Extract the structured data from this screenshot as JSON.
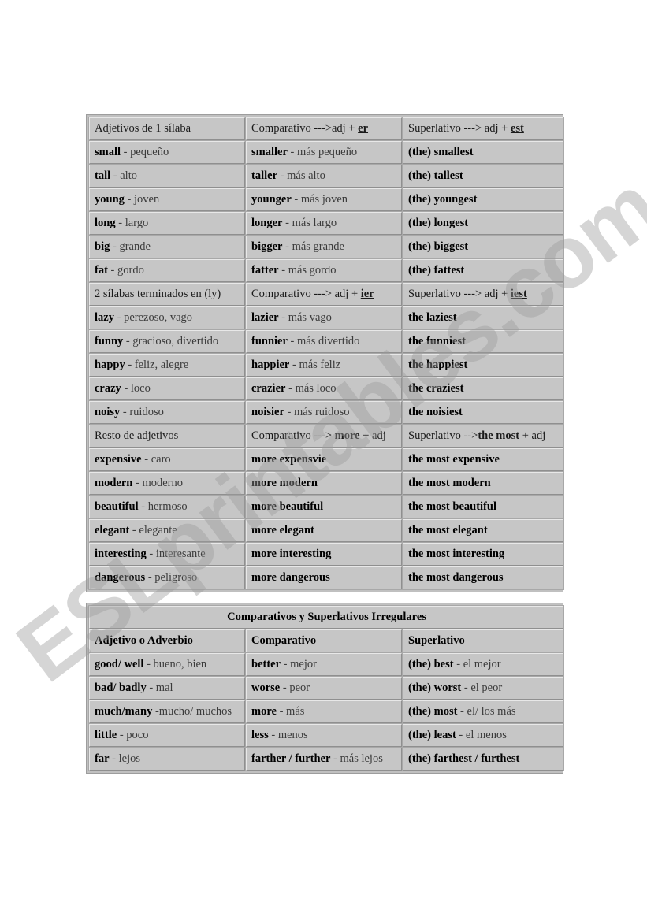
{
  "colors": {
    "highlight_yellow": "#ffff8a",
    "cell_gray": "#c6c6c6",
    "page_white": "#ffffff",
    "watermark_gray": "#9a9a9a"
  },
  "watermark": {
    "text": "ESLprintables.com"
  },
  "table_one": {
    "groups": [
      {
        "header": {
          "col1": "Adjetivos de 1 sílaba",
          "col2_pre": "Comparativo --->adj + ",
          "col2_kw": "er",
          "col2_post": "",
          "col3_pre": "Superlativo ---> adj + ",
          "col3_kw": "est",
          "col3_post": ""
        },
        "rows": [
          {
            "en": "small",
            "sep": " - ",
            "es": "pequeño",
            "comp_en": "smaller",
            "comp_sep": " - ",
            "comp_es": "más pequeño",
            "sup": "(the) smallest"
          },
          {
            "en": "tall",
            "sep": " - ",
            "es": "alto",
            "comp_en": "taller",
            "comp_sep": " - ",
            "comp_es": "más alto",
            "sup": "(the) tallest"
          },
          {
            "en": "young",
            "sep": " - ",
            "es": "joven",
            "comp_en": "younger",
            "comp_sep": " - ",
            "comp_es": "más joven",
            "sup": "(the) youngest"
          },
          {
            "en": "long",
            "sep": " - ",
            "es": "largo",
            "comp_en": "longer",
            "comp_sep": " - ",
            "comp_es": "más largo",
            "sup": "(the) longest"
          },
          {
            "en": "big",
            "sep": " - ",
            "es": "grande",
            "comp_en": "bigger",
            "comp_sep": " - ",
            "comp_es": "más grande",
            "sup": "(the) biggest"
          },
          {
            "en": "fat",
            "sep": " - ",
            "es": "gordo",
            "comp_en": "fatter",
            "comp_sep": " - ",
            "comp_es": "más gordo",
            "sup": "(the) fattest"
          }
        ]
      },
      {
        "header": {
          "col1": "2 sílabas terminados en (ly)",
          "col2_pre": "Comparativo ---> adj + ",
          "col2_kw": "ier",
          "col2_post": "",
          "col3_pre": "Superlativo ---> adj + ",
          "col3_kw": "iest",
          "col3_post": ""
        },
        "rows": [
          {
            "en": "lazy",
            "sep": " - ",
            "es": "perezoso, vago",
            "comp_en": "lazier",
            "comp_sep": " - ",
            "comp_es": "más vago",
            "sup": "the laziest"
          },
          {
            "en": "funny",
            "sep": " - ",
            "es": "gracioso, divertido",
            "comp_en": "funnier",
            "comp_sep": " - ",
            "comp_es": "más divertido",
            "sup": "the funniest"
          },
          {
            "en": "happy",
            "sep": " - ",
            "es": "feliz, alegre",
            "comp_en": "happier",
            "comp_sep": " - ",
            "comp_es": "más feliz",
            "sup": "the happiest"
          },
          {
            "en": "crazy",
            "sep": " - ",
            "es": "loco",
            "comp_en": "crazier",
            "comp_sep": " - ",
            "comp_es": "más loco",
            "sup": "the craziest"
          },
          {
            "en": "noisy",
            "sep": " - ",
            "es": "ruidoso",
            "comp_en": "noisier",
            "comp_sep": " - ",
            "comp_es": "más ruidoso",
            "sup": "the noisiest"
          }
        ]
      },
      {
        "header": {
          "col1": "Resto de adjetivos",
          "col2_pre": "Comparativo ---> ",
          "col2_kw": "more",
          "col2_post": " + adj",
          "col3_pre": "Superlativo -->",
          "col3_kw": "the most",
          "col3_post": " + adj"
        },
        "rows": [
          {
            "en": "expensive",
            "sep": " - ",
            "es": "caro",
            "comp_en": "more expensvie",
            "comp_sep": "",
            "comp_es": "",
            "sup": "the most expensive"
          },
          {
            "en": "modern",
            "sep": " - ",
            "es": "moderno",
            "comp_en": "more modern",
            "comp_sep": "",
            "comp_es": "",
            "sup": "the most modern"
          },
          {
            "en": "beautiful",
            "sep": " - ",
            "es": "hermoso",
            "comp_en": "more beautiful",
            "comp_sep": "",
            "comp_es": "",
            "sup": "the most beautiful"
          },
          {
            "en": "elegant",
            "sep": " - ",
            "es": "elegante",
            "comp_en": "more elegant",
            "comp_sep": "",
            "comp_es": "",
            "sup": "the most elegant"
          },
          {
            "en": "interesting",
            "sep": " - ",
            "es": "interesante",
            "comp_en": "more interesting",
            "comp_sep": "",
            "comp_es": "",
            "sup": "the most interesting"
          },
          {
            "en": "dangerous",
            "sep": " - ",
            "es": "peligroso",
            "comp_en": "more dangerous",
            "comp_sep": "",
            "comp_es": "",
            "sup": "the most dangerous"
          }
        ]
      }
    ]
  },
  "table_two": {
    "title": "Comparativos y Superlativos Irregulares",
    "headers": {
      "col1": "Adjetivo o Adverbio",
      "col2": "Comparativo",
      "col3": "Superlativo"
    },
    "rows": [
      {
        "en": "good/ well",
        "sep": " - ",
        "es": "bueno, bien",
        "comp_en": "better",
        "comp_sep": " - ",
        "comp_es": "mejor",
        "sup_en": "(the) best",
        "sup_sep": " - ",
        "sup_es": "el mejor"
      },
      {
        "en": "bad/ badly",
        "sep": " - ",
        "es": "mal",
        "comp_en": "worse",
        "comp_sep": " - ",
        "comp_es": "peor",
        "sup_en": "(the) worst",
        "sup_sep": " - ",
        "sup_es": "el peor"
      },
      {
        "en": "much/many",
        "sep": " -",
        "es": "mucho/ muchos",
        "comp_en": "more",
        "comp_sep": " - ",
        "comp_es": "más",
        "sup_en": "(the) most",
        "sup_sep": " - ",
        "sup_es": "el/ los más"
      },
      {
        "en": "little",
        "sep": " - ",
        "es": "poco",
        "comp_en": "less",
        "comp_sep": " - ",
        "comp_es": "menos",
        "sup_en": "(the) least",
        "sup_sep": " - ",
        "sup_es": "el menos"
      },
      {
        "en": "far",
        "sep": " - ",
        "es": "lejos",
        "comp_en": "farther / further",
        "comp_sep": " - ",
        "comp_es": "más lejos",
        "sup_en": "(the) farthest / furthest",
        "sup_sep": "",
        "sup_es": ""
      }
    ]
  }
}
